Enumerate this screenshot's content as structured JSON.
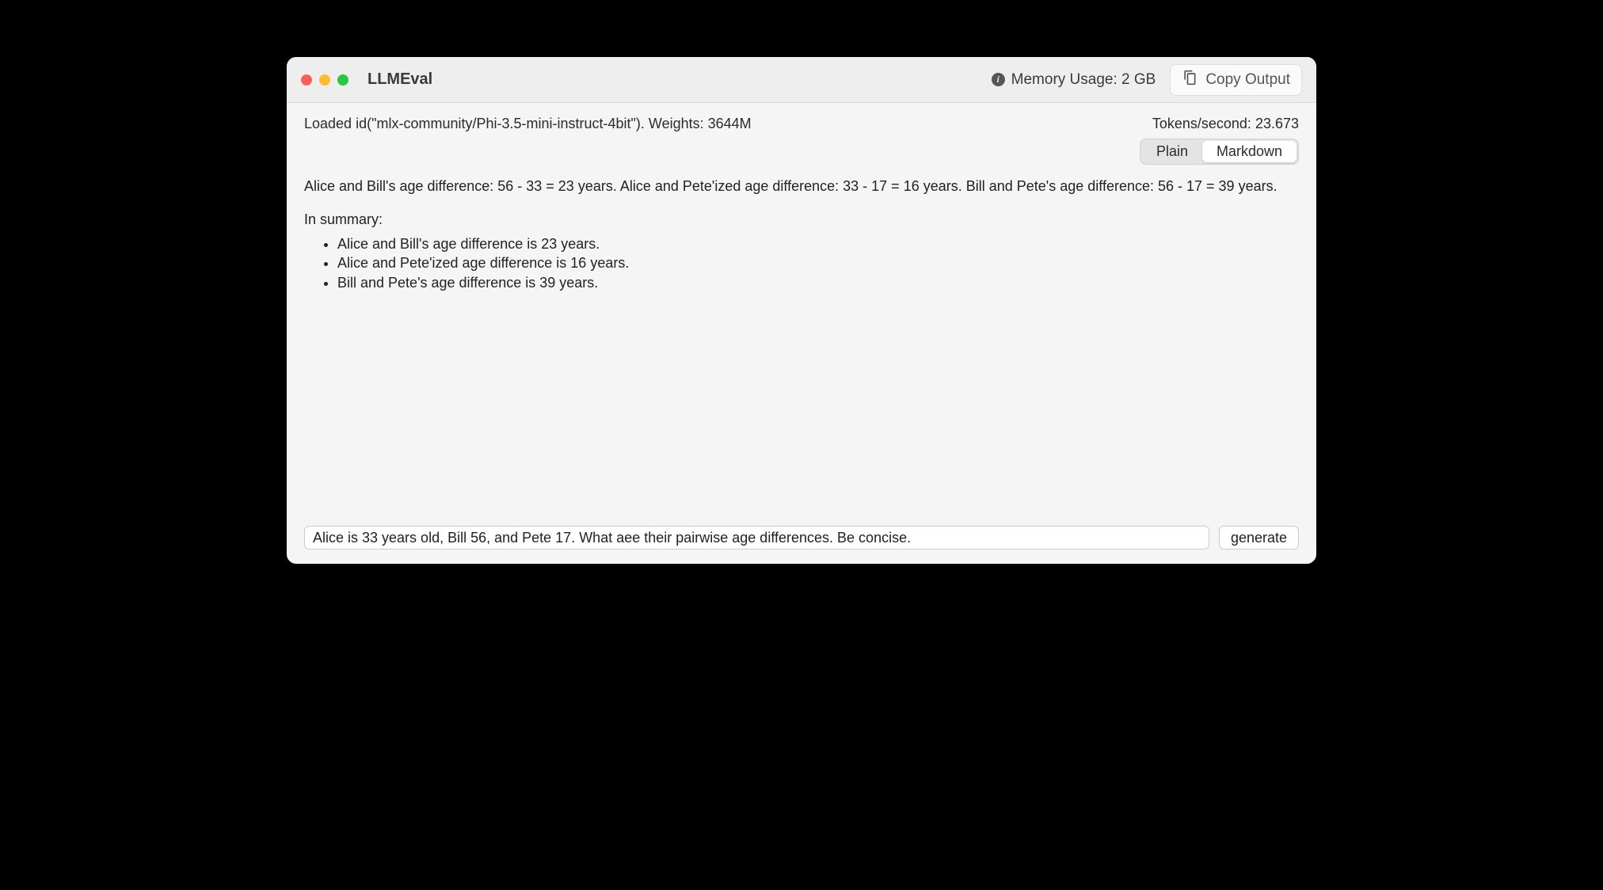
{
  "window": {
    "title": "LLMEval"
  },
  "header": {
    "memory_label": "Memory Usage: 2 GB",
    "copy_label": "Copy Output"
  },
  "status": {
    "loaded_text": "Loaded id(\"mlx-community/Phi-3.5-mini-instruct-4bit\").  Weights: 3644M",
    "tokens_per_second": "Tokens/second: 23.673"
  },
  "view_mode": {
    "plain": "Plain",
    "markdown": "Markdown",
    "active": "markdown"
  },
  "output": {
    "paragraph1": "Alice and Bill's age difference: 56 - 33 = 23 years. Alice and Pete'ized age difference: 33 - 17 = 16 years. Bill and Pete's age difference: 56 - 17 = 39 years.",
    "summary_label": "In summary:",
    "bullets": [
      "Alice and Bill's age difference is 23 years.",
      "Alice and Pete'ized age difference is 16 years.",
      "Bill and Pete's age difference is 39 years."
    ]
  },
  "prompt": {
    "value": "Alice is 33 years old, Bill 56, and Pete 17. What aee their pairwise age differences. Be concise.",
    "generate_label": "generate"
  }
}
